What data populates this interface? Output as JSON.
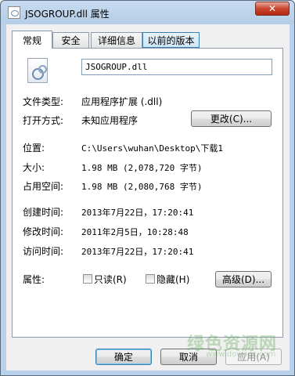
{
  "window": {
    "title": "JSOGROUP.dll 属性",
    "close_label": "✕"
  },
  "tabs": [
    {
      "label": "常规"
    },
    {
      "label": "安全"
    },
    {
      "label": "详细信息"
    },
    {
      "label": "以前的版本"
    }
  ],
  "general": {
    "file_name": "JSOGROUP.dll",
    "file_type_label": "文件类型:",
    "file_type_value": "应用程序扩展 (.dll)",
    "open_with_label": "打开方式:",
    "open_with_value": "未知应用程序",
    "change_button": "更改(C)...",
    "location_label": "位置:",
    "location_value": "C:\\Users\\wuhan\\Desktop\\下载1",
    "size_label": "大小:",
    "size_value": "1.98 MB (2,078,720 字节)",
    "size_on_disk_label": "占用空间:",
    "size_on_disk_value": "1.98 MB (2,080,768 字节)",
    "created_label": "创建时间:",
    "created_value": "2013年7月22日，17:20:41",
    "modified_label": "修改时间:",
    "modified_value": "2011年2月5日，10:28:48",
    "accessed_label": "访问时间:",
    "accessed_value": "2013年7月22日，17:20:41",
    "attributes_label": "属性:",
    "readonly_label": "只读(R)",
    "hidden_label": "隐藏(H)",
    "advanced_button": "高级(D)..."
  },
  "footer": {
    "ok_button": "确定",
    "cancel_button": "取消",
    "apply_button": "应用(A)"
  },
  "watermark": {
    "text": "绿色资源网",
    "sub": "www.downcc.com"
  }
}
